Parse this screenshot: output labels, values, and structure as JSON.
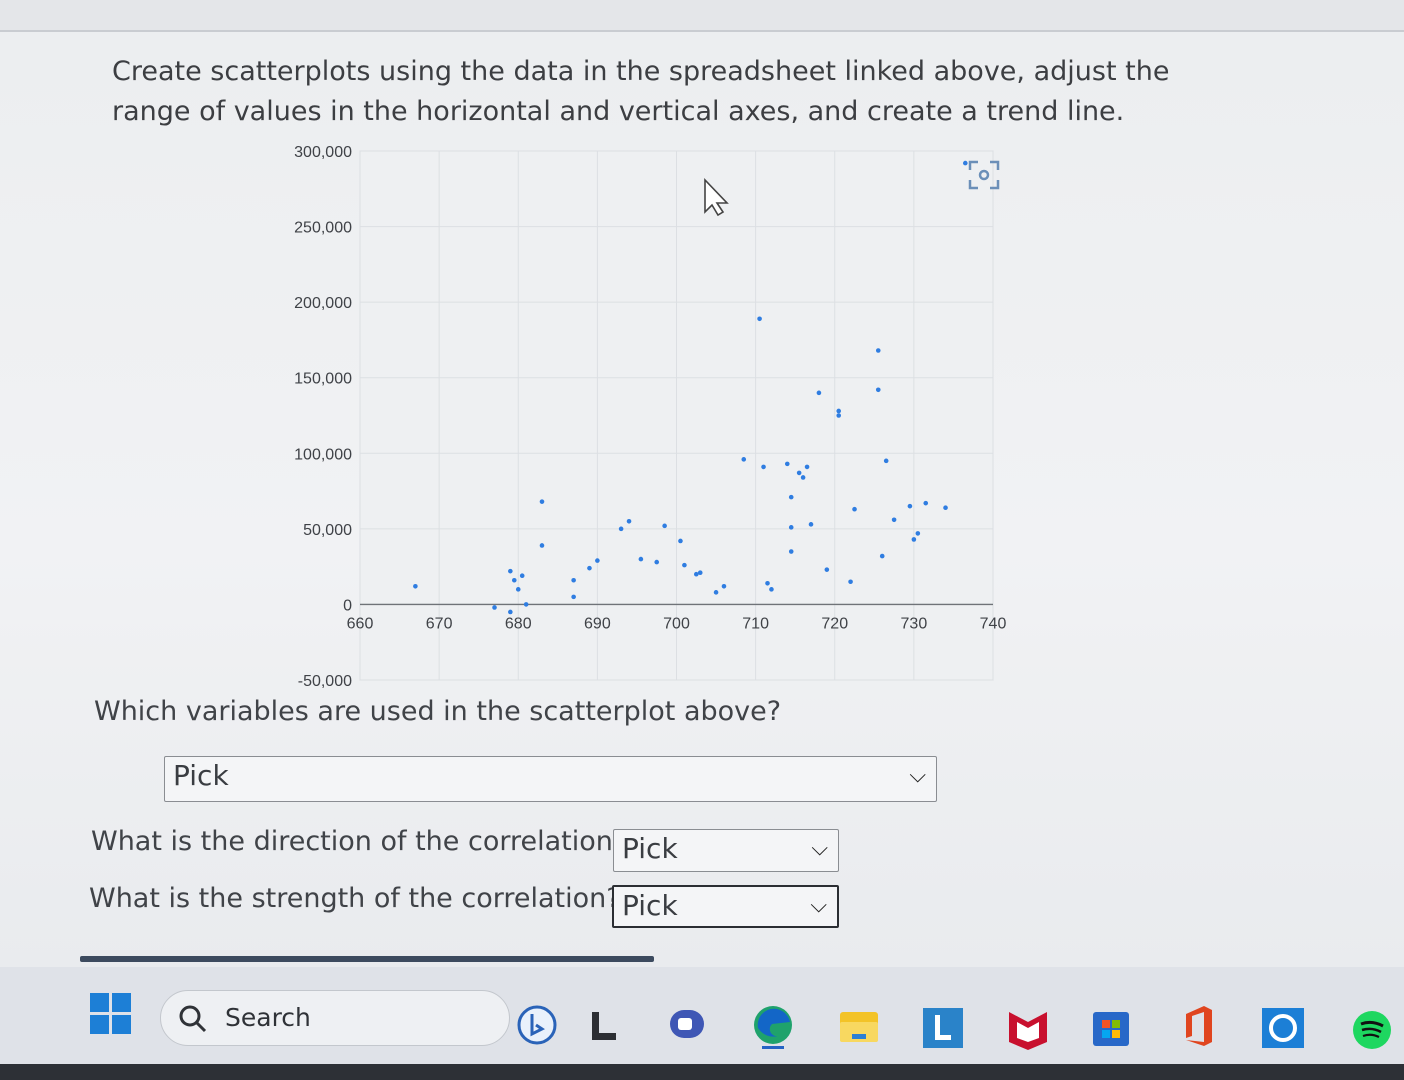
{
  "instruction": "Create scatterplots using the data in the spreadsheet linked above, adjust the range of values in the horizontal and vertical axes, and create a trend line.",
  "chart_data": {
    "type": "scatter",
    "xlim": [
      660,
      740
    ],
    "ylim": [
      -50000,
      300000
    ],
    "x_ticks": [
      660,
      670,
      680,
      690,
      700,
      710,
      720,
      730,
      740
    ],
    "y_ticks": [
      300000,
      250000,
      200000,
      150000,
      100000,
      50000,
      0,
      -50000
    ],
    "x_tick_labels": [
      "660",
      "670",
      "680",
      "690",
      "700",
      "710",
      "720",
      "730",
      "740"
    ],
    "y_tick_labels": [
      "300,000",
      "250,000",
      "200,000",
      "150,000",
      "100,000",
      "50,000",
      "0",
      "-50,000"
    ],
    "grid": true,
    "point_color": "#2f7de1",
    "points": [
      [
        667,
        12000
      ],
      [
        677,
        -2000
      ],
      [
        679,
        -5000
      ],
      [
        679,
        22000
      ],
      [
        679.5,
        16000
      ],
      [
        680,
        10000
      ],
      [
        680.5,
        19000
      ],
      [
        681,
        0
      ],
      [
        683,
        39000
      ],
      [
        683,
        68000
      ],
      [
        687,
        5000
      ],
      [
        687,
        16000
      ],
      [
        689,
        24000
      ],
      [
        690,
        29000
      ],
      [
        693,
        50000
      ],
      [
        694,
        55000
      ],
      [
        695.5,
        30000
      ],
      [
        697.5,
        28000
      ],
      [
        698.5,
        52000
      ],
      [
        700.5,
        42000
      ],
      [
        701,
        26000
      ],
      [
        702.5,
        20000
      ],
      [
        703,
        21000
      ],
      [
        705,
        8000
      ],
      [
        706,
        12000
      ],
      [
        708.5,
        96000
      ],
      [
        710.5,
        189000
      ],
      [
        711,
        91000
      ],
      [
        711.5,
        14000
      ],
      [
        712,
        10000
      ],
      [
        714,
        93000
      ],
      [
        714.5,
        35000
      ],
      [
        714.5,
        51000
      ],
      [
        714.5,
        71000
      ],
      [
        715.5,
        87000
      ],
      [
        716,
        84000
      ],
      [
        716.5,
        91000
      ],
      [
        717,
        53000
      ],
      [
        718,
        140000
      ],
      [
        719,
        23000
      ],
      [
        720.5,
        125000
      ],
      [
        720.5,
        128000
      ],
      [
        722,
        15000
      ],
      [
        722.5,
        63000
      ],
      [
        725.5,
        168000
      ],
      [
        725.5,
        142000
      ],
      [
        726,
        32000
      ],
      [
        726.5,
        95000
      ],
      [
        727.5,
        56000
      ],
      [
        729.5,
        65000
      ],
      [
        730,
        43000
      ],
      [
        730.5,
        47000
      ],
      [
        731.5,
        67000
      ],
      [
        734,
        64000
      ],
      [
        736.5,
        292000
      ]
    ]
  },
  "questions": {
    "q1": {
      "label": "Which variables are used in the scatterplot above?",
      "value": "Pick"
    },
    "q2": {
      "label": "What is the direction of the correlation?",
      "value": "Pick"
    },
    "q3": {
      "label": "What is the strength of the correlation?",
      "value": "Pick"
    }
  },
  "taskbar": {
    "search_label": "Search",
    "icons": [
      "bing-chat-icon",
      "l-app-icon",
      "teams-icon",
      "edge-icon",
      "file-explorer-icon",
      "l-tile-icon",
      "mcafee-icon",
      "microsoft-store-icon",
      "office-icon",
      "cortana-icon",
      "spotify-icon"
    ]
  }
}
